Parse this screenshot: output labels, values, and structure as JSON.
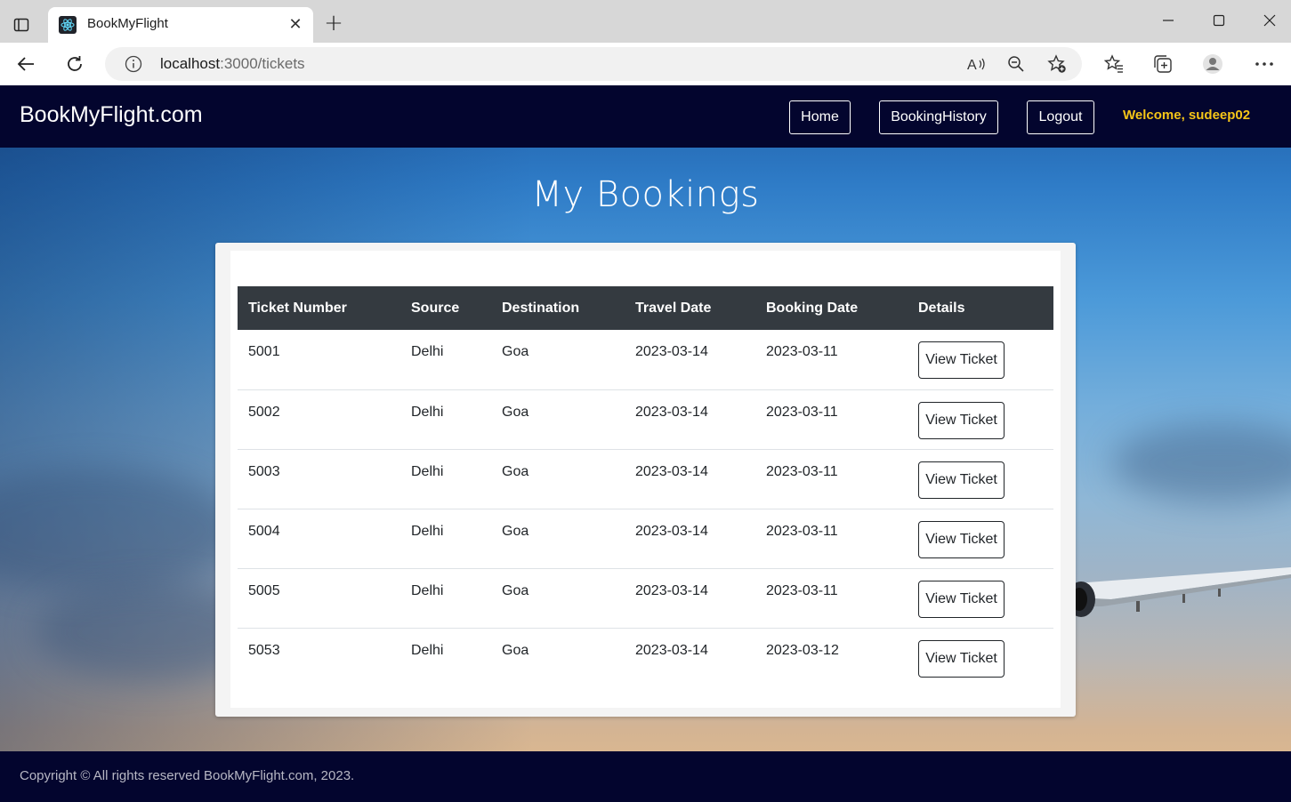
{
  "browser": {
    "tab_title": "BookMyFlight",
    "url_host": "localhost",
    "url_path": ":3000/tickets"
  },
  "navbar": {
    "brand": "BookMyFlight.com",
    "links": [
      "Home",
      "BookingHistory",
      "Logout"
    ],
    "welcome": "Welcome, sudeep02"
  },
  "page": {
    "title": "My Bookings"
  },
  "table": {
    "columns": [
      "Ticket Number",
      "Source",
      "Destination",
      "Travel Date",
      "Booking Date",
      "Details"
    ],
    "rows": [
      {
        "ticket": "5001",
        "source": "Delhi",
        "destination": "Goa",
        "travel_date": "2023-03-14",
        "booking_date": "2023-03-11",
        "action": "View Ticket"
      },
      {
        "ticket": "5002",
        "source": "Delhi",
        "destination": "Goa",
        "travel_date": "2023-03-14",
        "booking_date": "2023-03-11",
        "action": "View Ticket"
      },
      {
        "ticket": "5003",
        "source": "Delhi",
        "destination": "Goa",
        "travel_date": "2023-03-14",
        "booking_date": "2023-03-11",
        "action": "View Ticket"
      },
      {
        "ticket": "5004",
        "source": "Delhi",
        "destination": "Goa",
        "travel_date": "2023-03-14",
        "booking_date": "2023-03-11",
        "action": "View Ticket"
      },
      {
        "ticket": "5005",
        "source": "Delhi",
        "destination": "Goa",
        "travel_date": "2023-03-14",
        "booking_date": "2023-03-11",
        "action": "View Ticket"
      },
      {
        "ticket": "5053",
        "source": "Delhi",
        "destination": "Goa",
        "travel_date": "2023-03-14",
        "booking_date": "2023-03-12",
        "action": "View Ticket"
      }
    ]
  },
  "footer": {
    "text": "Copyright © All rights reserved BookMyFlight.com, 2023."
  },
  "icons": {
    "browser_toolbar": [
      "read-aloud-icon",
      "zoom-out-icon",
      "add-favorite-icon",
      "favorites-icon",
      "collections-icon",
      "profile-icon",
      "more-icon"
    ]
  },
  "colors": {
    "navbar_bg": "#03052e",
    "welcome": "#f5c518",
    "table_header_bg": "#343a40"
  }
}
